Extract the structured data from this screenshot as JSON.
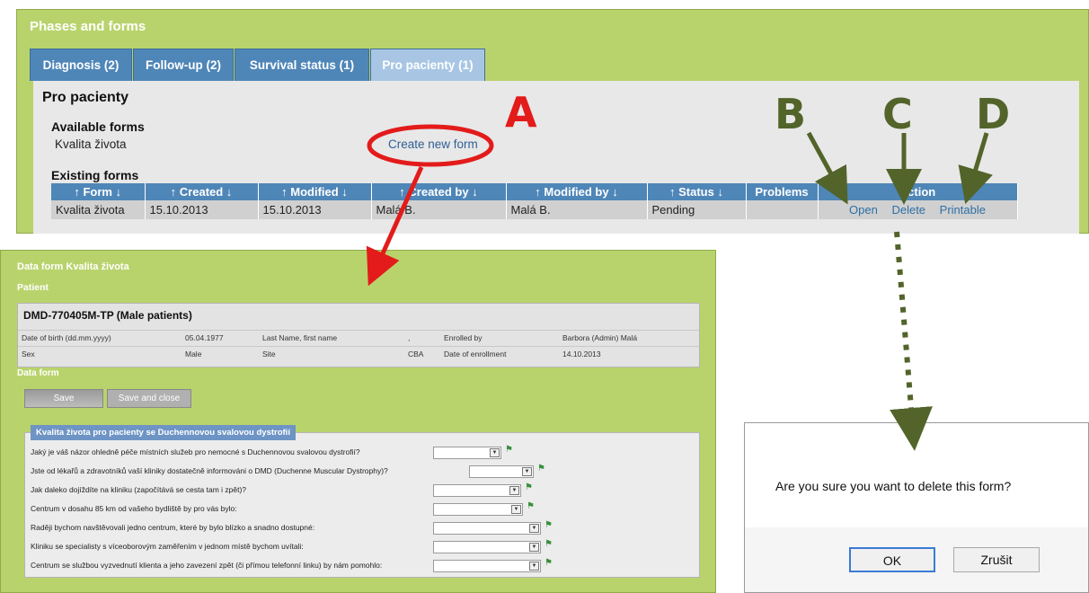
{
  "top": {
    "title": "Phases and forms",
    "tabs": [
      {
        "label": "Diagnosis (2)"
      },
      {
        "label": "Follow-up (2)"
      },
      {
        "label": "Survival status (1)"
      },
      {
        "label": "Pro pacienty (1)"
      }
    ],
    "active_tab_index": 3,
    "section_title": "Pro pacienty",
    "available_heading": "Available forms",
    "available_form": "Kvalita života",
    "create_link": "Create new form",
    "existing_heading": "Existing forms",
    "columns": [
      "↑ Form ↓",
      "↑ Created ↓",
      "↑ Modified ↓",
      "↑ Created by ↓",
      "↑ Modified by ↓",
      "↑ Status ↓",
      "Problems",
      "Action"
    ],
    "row": {
      "form": "Kvalita života",
      "created": "15.10.2013",
      "modified": "15.10.2013",
      "created_by": "Malá B.",
      "modified_by": "Malá B.",
      "status": "Pending",
      "problems": "",
      "actions": [
        "Open",
        "Delete",
        "Printable"
      ]
    }
  },
  "data_form": {
    "title": "Data form Kvalita života",
    "patient_label": "Patient",
    "patient_id": "DMD-770405M-TP (Male patients)",
    "rows": [
      {
        "c1": "Date of birth (dd.mm.yyyy)",
        "c2": "05.04.1977",
        "c3": "Last Name, first name",
        "c4": ",",
        "c5": "Enrolled by",
        "c6": "Barbora (Admin) Malá"
      },
      {
        "c1": "Sex",
        "c2": "Male",
        "c3": "Site",
        "c4": "CBA",
        "c5": "Date of enrollment",
        "c6": "14.10.2013"
      }
    ],
    "dataform_label": "Data form",
    "save_label": "Save",
    "save_close_label": "Save and close",
    "questions_legend": "Kvalita života pro pacienty se Duchennovou svalovou dystrofií",
    "questions": [
      "Jaký je váš názor ohledně péče místních služeb pro nemocné s Duchennovou svalovou dystrofií?",
      "Jste od lékařů a zdravotníků vaší kliniky dostatečně informováni o DMD (Duchenne Muscular Dystrophy)?",
      "Jak daleko dojíždíte na kliniku (započítává se cesta tam i zpět)?",
      "Centrum v dosahu 85 km od vašeho bydliště by pro vás bylo:",
      "Raději bychom navštěvovali jedno centrum, které by bylo blízko a snadno dostupné:",
      "Kliniku se specialisty s víceoborovým zaměřením v jednom místě bychom uvítali:",
      "Centrum se službou vyzvednutí klienta a jeho zavezení zpět (či přímou telefonní linku) by nám pomohlo:"
    ]
  },
  "dialog": {
    "message": "Are you sure you want to delete this form?",
    "ok_label": "OK",
    "cancel_label": "Zrušit"
  },
  "annotations": {
    "a": "A",
    "b": "B",
    "c": "C",
    "d": "D",
    "red_color": "#e31b1b",
    "green_color": "#52642a"
  }
}
